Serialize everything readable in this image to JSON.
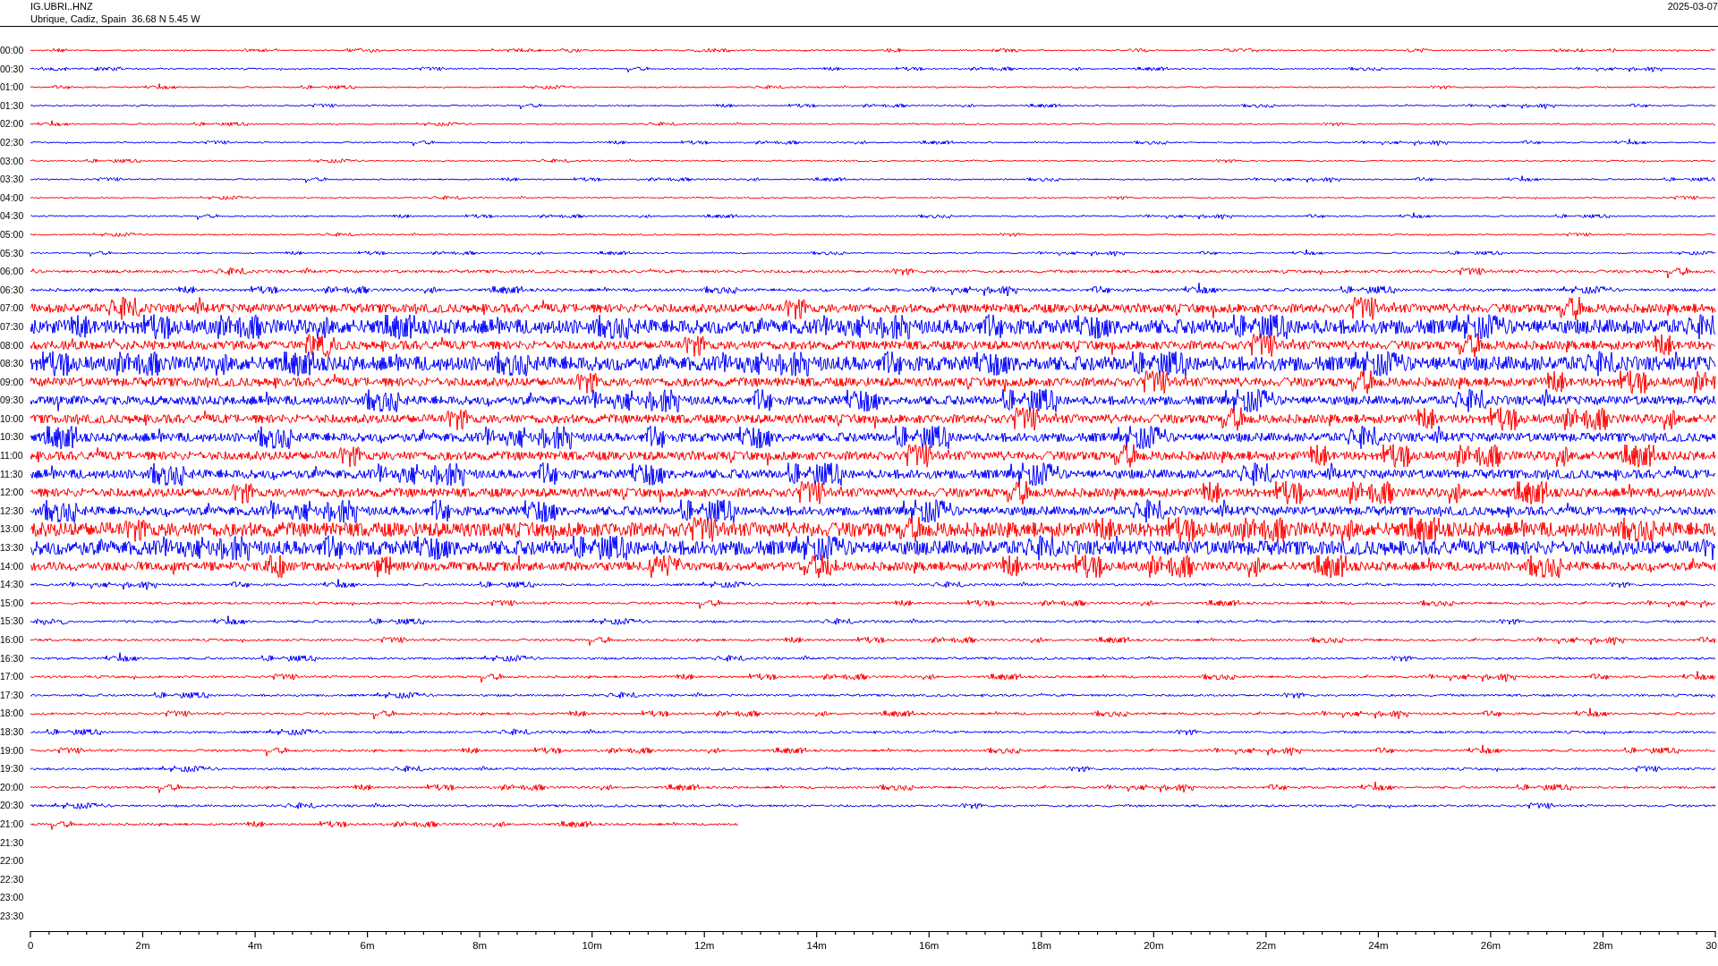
{
  "header": {
    "station": "IG.UBRI..HNZ",
    "location": "Ubrique, Cadiz, Spain  36.68 N 5.45 W",
    "date": "2025-03-07"
  },
  "rows": [
    {
      "time": "00:00",
      "color": "#ff0000",
      "level": 1
    },
    {
      "time": "00:30",
      "color": "#0000ff",
      "level": 1
    },
    {
      "time": "01:00",
      "color": "#ff0000",
      "level": 1
    },
    {
      "time": "01:30",
      "color": "#0000ff",
      "level": 1
    },
    {
      "time": "02:00",
      "color": "#ff0000",
      "level": 1
    },
    {
      "time": "02:30",
      "color": "#0000ff",
      "level": 1
    },
    {
      "time": "03:00",
      "color": "#ff0000",
      "level": 1
    },
    {
      "time": "03:30",
      "color": "#0000ff",
      "level": 1
    },
    {
      "time": "04:00",
      "color": "#ff0000",
      "level": 1
    },
    {
      "time": "04:30",
      "color": "#0000ff",
      "level": 1
    },
    {
      "time": "05:00",
      "color": "#ff0000",
      "level": 1
    },
    {
      "time": "05:30",
      "color": "#0000ff",
      "level": 1
    },
    {
      "time": "06:00",
      "color": "#ff0000",
      "level": 1
    },
    {
      "time": "06:30",
      "color": "#0000ff",
      "level": 1
    },
    {
      "time": "07:00",
      "color": "#ff0000",
      "level": 1
    },
    {
      "time": "07:30",
      "color": "#0000ff",
      "level": 1
    },
    {
      "time": "08:00",
      "color": "#ff0000",
      "level": 1
    },
    {
      "time": "08:30",
      "color": "#0000ff",
      "level": 1
    },
    {
      "time": "09:00",
      "color": "#ff0000",
      "level": 1
    },
    {
      "time": "09:30",
      "color": "#0000ff",
      "level": 1
    },
    {
      "time": "10:00",
      "color": "#ff0000",
      "level": 1
    },
    {
      "time": "10:30",
      "color": "#0000ff",
      "level": 1
    },
    {
      "time": "11:00",
      "color": "#ff0000",
      "level": 1
    },
    {
      "time": "11:30",
      "color": "#0000ff",
      "level": 1
    },
    {
      "time": "12:00",
      "color": "#ff0000",
      "level": 1
    },
    {
      "time": "12:30",
      "color": "#0000ff",
      "level": 1
    },
    {
      "time": "13:00",
      "color": "#ff0000",
      "level": 1
    },
    {
      "time": "13:30",
      "color": "#0000ff",
      "level": 1
    },
    {
      "time": "14:00",
      "color": "#ff0000",
      "level": 1
    },
    {
      "time": "14:30",
      "color": "#0000ff",
      "level": 1
    },
    {
      "time": "15:00",
      "color": "#ff0000",
      "level": 1
    },
    {
      "time": "15:30",
      "color": "#0000ff",
      "level": 1
    },
    {
      "time": "16:00",
      "color": "#ff0000",
      "level": 1
    },
    {
      "time": "16:30",
      "color": "#0000ff",
      "level": 1
    },
    {
      "time": "17:00",
      "color": "#ff0000",
      "level": 1
    },
    {
      "time": "17:30",
      "color": "#0000ff",
      "level": 1
    },
    {
      "time": "18:00",
      "color": "#ff0000",
      "level": 1
    },
    {
      "time": "18:30",
      "color": "#0000ff",
      "level": 1
    },
    {
      "time": "19:00",
      "color": "#ff0000",
      "level": 1
    },
    {
      "time": "19:30",
      "color": "#0000ff",
      "level": 1
    },
    {
      "time": "20:00",
      "color": "#ff0000",
      "level": 1
    },
    {
      "time": "20:30",
      "color": "#0000ff",
      "level": 1
    },
    {
      "time": "21:00",
      "color": "#ff0000",
      "level": 0.42
    },
    {
      "time": "21:30"
    },
    {
      "time": "22:00"
    },
    {
      "time": "22:30"
    },
    {
      "time": "23:00"
    },
    {
      "time": "23:30"
    }
  ],
  "axis": {
    "ticks": [
      "0",
      "2m",
      "4m",
      "6m",
      "8m",
      "10m",
      "12m",
      "14m",
      "16m",
      "18m",
      "20m",
      "22m",
      "24m",
      "26m",
      "28m",
      "30"
    ]
  }
}
